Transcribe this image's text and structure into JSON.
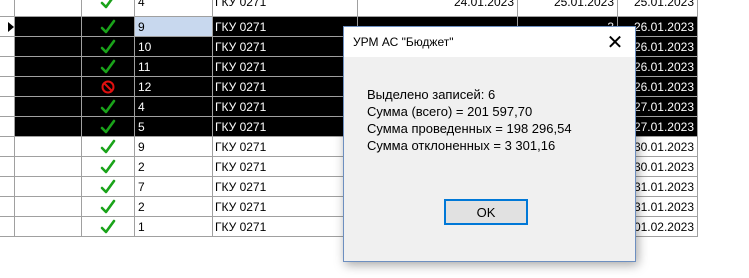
{
  "dialog": {
    "title": "УРМ АС \"Бюджет\"",
    "close_glyph": "✕",
    "lines": [
      "Выделено записей: 6",
      "Сумма (всего) = 201 597,70",
      "Сумма проведенных = 198 296,54",
      "Сумма отклоненных = 3 301,16"
    ],
    "ok_label": "OK"
  },
  "rows": [
    {
      "status": "check",
      "num": "4",
      "code": "ГКУ 0271",
      "date1": "24.01.2023",
      "date2": "25.01.2023",
      "date3": "25.01.2023",
      "selected": false
    },
    {
      "status": "check",
      "num": "9",
      "code": "ГКУ 0271",
      "date1": "",
      "date2": "3",
      "date3": "26.01.2023",
      "selected": true,
      "current": true
    },
    {
      "status": "check",
      "num": "10",
      "code": "ГКУ 0271",
      "date1": "",
      "date2": "3",
      "date3": "26.01.2023",
      "selected": true
    },
    {
      "status": "check",
      "num": "11",
      "code": "ГКУ 0271",
      "date1": "",
      "date2": "3",
      "date3": "26.01.2023",
      "selected": true
    },
    {
      "status": "reject",
      "num": "12",
      "code": "ГКУ 0271",
      "date1": "",
      "date2": "",
      "date3": "26.01.2023",
      "selected": true
    },
    {
      "status": "check",
      "num": "4",
      "code": "ГКУ 0271",
      "date1": "",
      "date2": "3",
      "date3": "27.01.2023",
      "selected": true
    },
    {
      "status": "check",
      "num": "5",
      "code": "ГКУ 0271",
      "date1": "",
      "date2": "3",
      "date3": "27.01.2023",
      "selected": true
    },
    {
      "status": "check",
      "num": "9",
      "code": "ГКУ 0271",
      "date1": "",
      "date2": "23",
      "date3": "30.01.2023",
      "selected": false
    },
    {
      "status": "check",
      "num": "2",
      "code": "ГКУ 0271",
      "date1": "",
      "date2": "23",
      "date3": "30.01.2023",
      "selected": false
    },
    {
      "status": "check",
      "num": "7",
      "code": "ГКУ 0271",
      "date1": "",
      "date2": "23",
      "date3": "31.01.2023",
      "selected": false
    },
    {
      "status": "check",
      "num": "2",
      "code": "ГКУ 0271",
      "date1": "30.01.2023",
      "date2": "31.01.2023",
      "date3": "31.01.2023",
      "selected": false
    },
    {
      "status": "check",
      "num": "1",
      "code": "ГКУ 0271",
      "date1": "31.01.2023",
      "date2": "01.02.2023",
      "date3": "01.02.2023",
      "selected": false
    }
  ],
  "colors": {
    "check": "#1aa31a",
    "reject": "#e01010",
    "selection": "#000000",
    "current_cell": "#c8d8ee",
    "ok_border": "#0078d7"
  }
}
